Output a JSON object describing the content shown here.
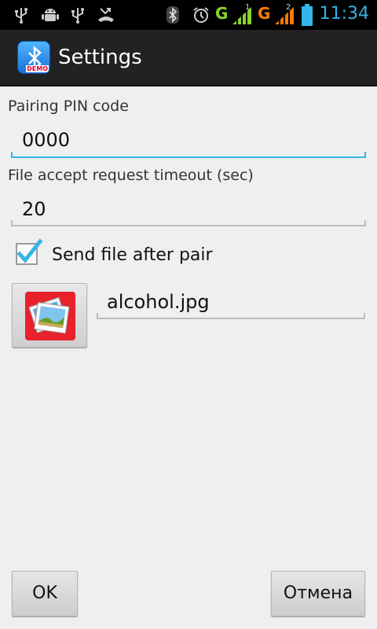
{
  "status_bar": {
    "time": "11:34",
    "network_1": "G",
    "network_2": "G",
    "sim_1": "1",
    "sim_2": "2",
    "icons": [
      "usb-icon",
      "android-debug-icon",
      "usb-icon",
      "missed-call-icon",
      "bluetooth-icon",
      "alarm-icon",
      "signal-icon",
      "battery-icon"
    ]
  },
  "action_bar": {
    "title": "Settings",
    "icon_badge": "DEMO"
  },
  "form": {
    "pin_label": "Pairing PIN code",
    "pin_value": "0000",
    "timeout_label": "File accept request timeout (sec)",
    "timeout_value": "20",
    "send_after_pair_label": "Send file after pair",
    "send_after_pair_checked": true,
    "file_name": "alcohol.jpg"
  },
  "buttons": {
    "ok": "OK",
    "cancel": "Отмена"
  },
  "colors": {
    "accent": "#33b5e5",
    "signal_green": "#8bd42e",
    "signal_orange": "#ff7a00"
  }
}
